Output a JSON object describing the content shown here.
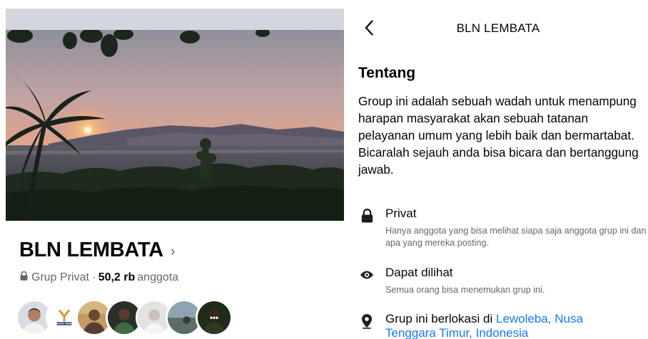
{
  "left": {
    "group_name": "BLN LEMBATA",
    "title_chevron": "›",
    "privacy_label": "Grup Privat ·",
    "member_count": "50,2 rb",
    "member_suffix": "anggota",
    "avatars": [
      "member-1",
      "member-2",
      "member-3",
      "member-4",
      "member-5",
      "member-6",
      "member-7"
    ],
    "avatar_logo_text": "KAYA TENE",
    "more_avatars_glyph": "•••"
  },
  "right": {
    "header_title": "BLN LEMBATA",
    "section_heading": "Tentang",
    "about_paragraph_1": "Group ini adalah sebuah wadah untuk menampung harapan masyarakat akan sebuah tatanan pelayanan umum yang lebih baik dan bermartabat.",
    "about_paragraph_2": "Bicaralah sejauh anda bisa bicara dan bertanggung jawab.",
    "privacy": {
      "label": "Privat",
      "description": "Hanya anggota yang bisa melihat siapa saja anggota grup ini dan apa yang mereka posting."
    },
    "visibility": {
      "label": "Dapat dilihat",
      "description": "Semua orang bisa menemukan grup ini."
    },
    "location": {
      "label_prefix": "Grup ini berlokasi di",
      "label_link_line1": "Lewoleba, Nusa",
      "label_link_line2": "Tenggara Timur, Indonesia"
    }
  },
  "colors": {
    "link": "#1877f2",
    "secondary_text": "#65676b",
    "primary_text": "#050505"
  }
}
